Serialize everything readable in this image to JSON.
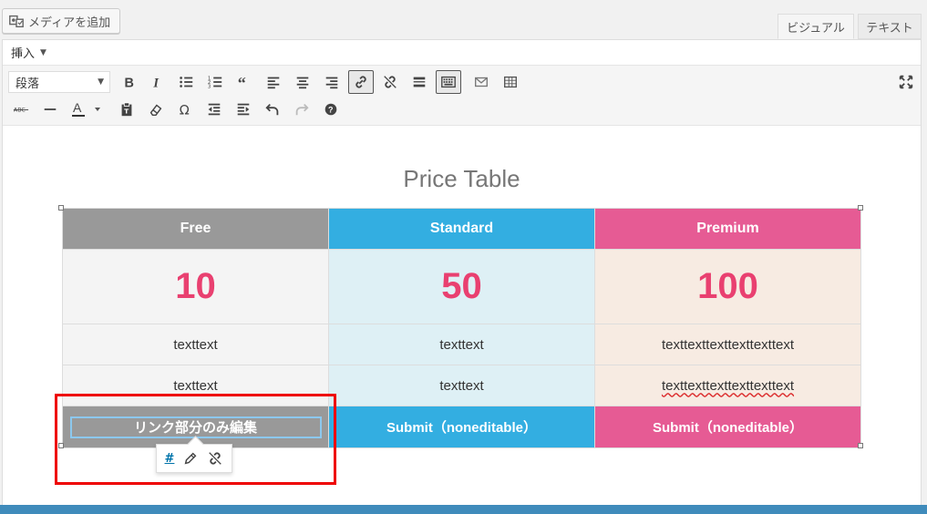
{
  "top": {
    "media_button_label": "メディアを追加",
    "tabs": [
      {
        "label": "ビジュアル",
        "active": true
      },
      {
        "label": "テキスト",
        "active": false
      }
    ]
  },
  "menubar": {
    "insert_label": "挿入"
  },
  "toolbar": {
    "format_select_value": "段落",
    "row1_icons": [
      "bold-icon",
      "italic-icon",
      "bullet-list-icon",
      "numbered-list-icon",
      "blockquote-icon",
      "align-left-icon",
      "align-center-icon",
      "align-right-icon",
      "link-icon",
      "unlink-icon",
      "read-more-icon",
      "toolbar-toggle-icon",
      "email-icon",
      "table-icon",
      "fullscreen-icon"
    ],
    "row2_icons": [
      "strikethrough-icon",
      "horizontal-line-icon",
      "text-color-icon",
      "paste-text-icon",
      "clear-formatting-icon",
      "special-char-icon",
      "outdent-icon",
      "indent-icon",
      "undo-icon",
      "redo-icon",
      "help-icon"
    ]
  },
  "content": {
    "title": "Price Table",
    "table": {
      "headers": [
        "Free",
        "Standard",
        "Premium"
      ],
      "prices": [
        "10",
        "50",
        "100"
      ],
      "row1": [
        "texttext",
        "texttext",
        "texttexttexttexttexttext"
      ],
      "row2": [
        "texttext",
        "texttext",
        "texttexttexttexttexttext"
      ],
      "buttons": [
        "リンク部分のみ編集",
        "Submit（noneditable）",
        "Submit（noneditable）"
      ]
    },
    "link_popup": {
      "url": "#"
    }
  },
  "colors": {
    "free_header": "#999999",
    "standard_header": "#33aee1",
    "premium_header": "#e65b94",
    "price_color": "#e94070",
    "highlight_box": "#e00000"
  }
}
